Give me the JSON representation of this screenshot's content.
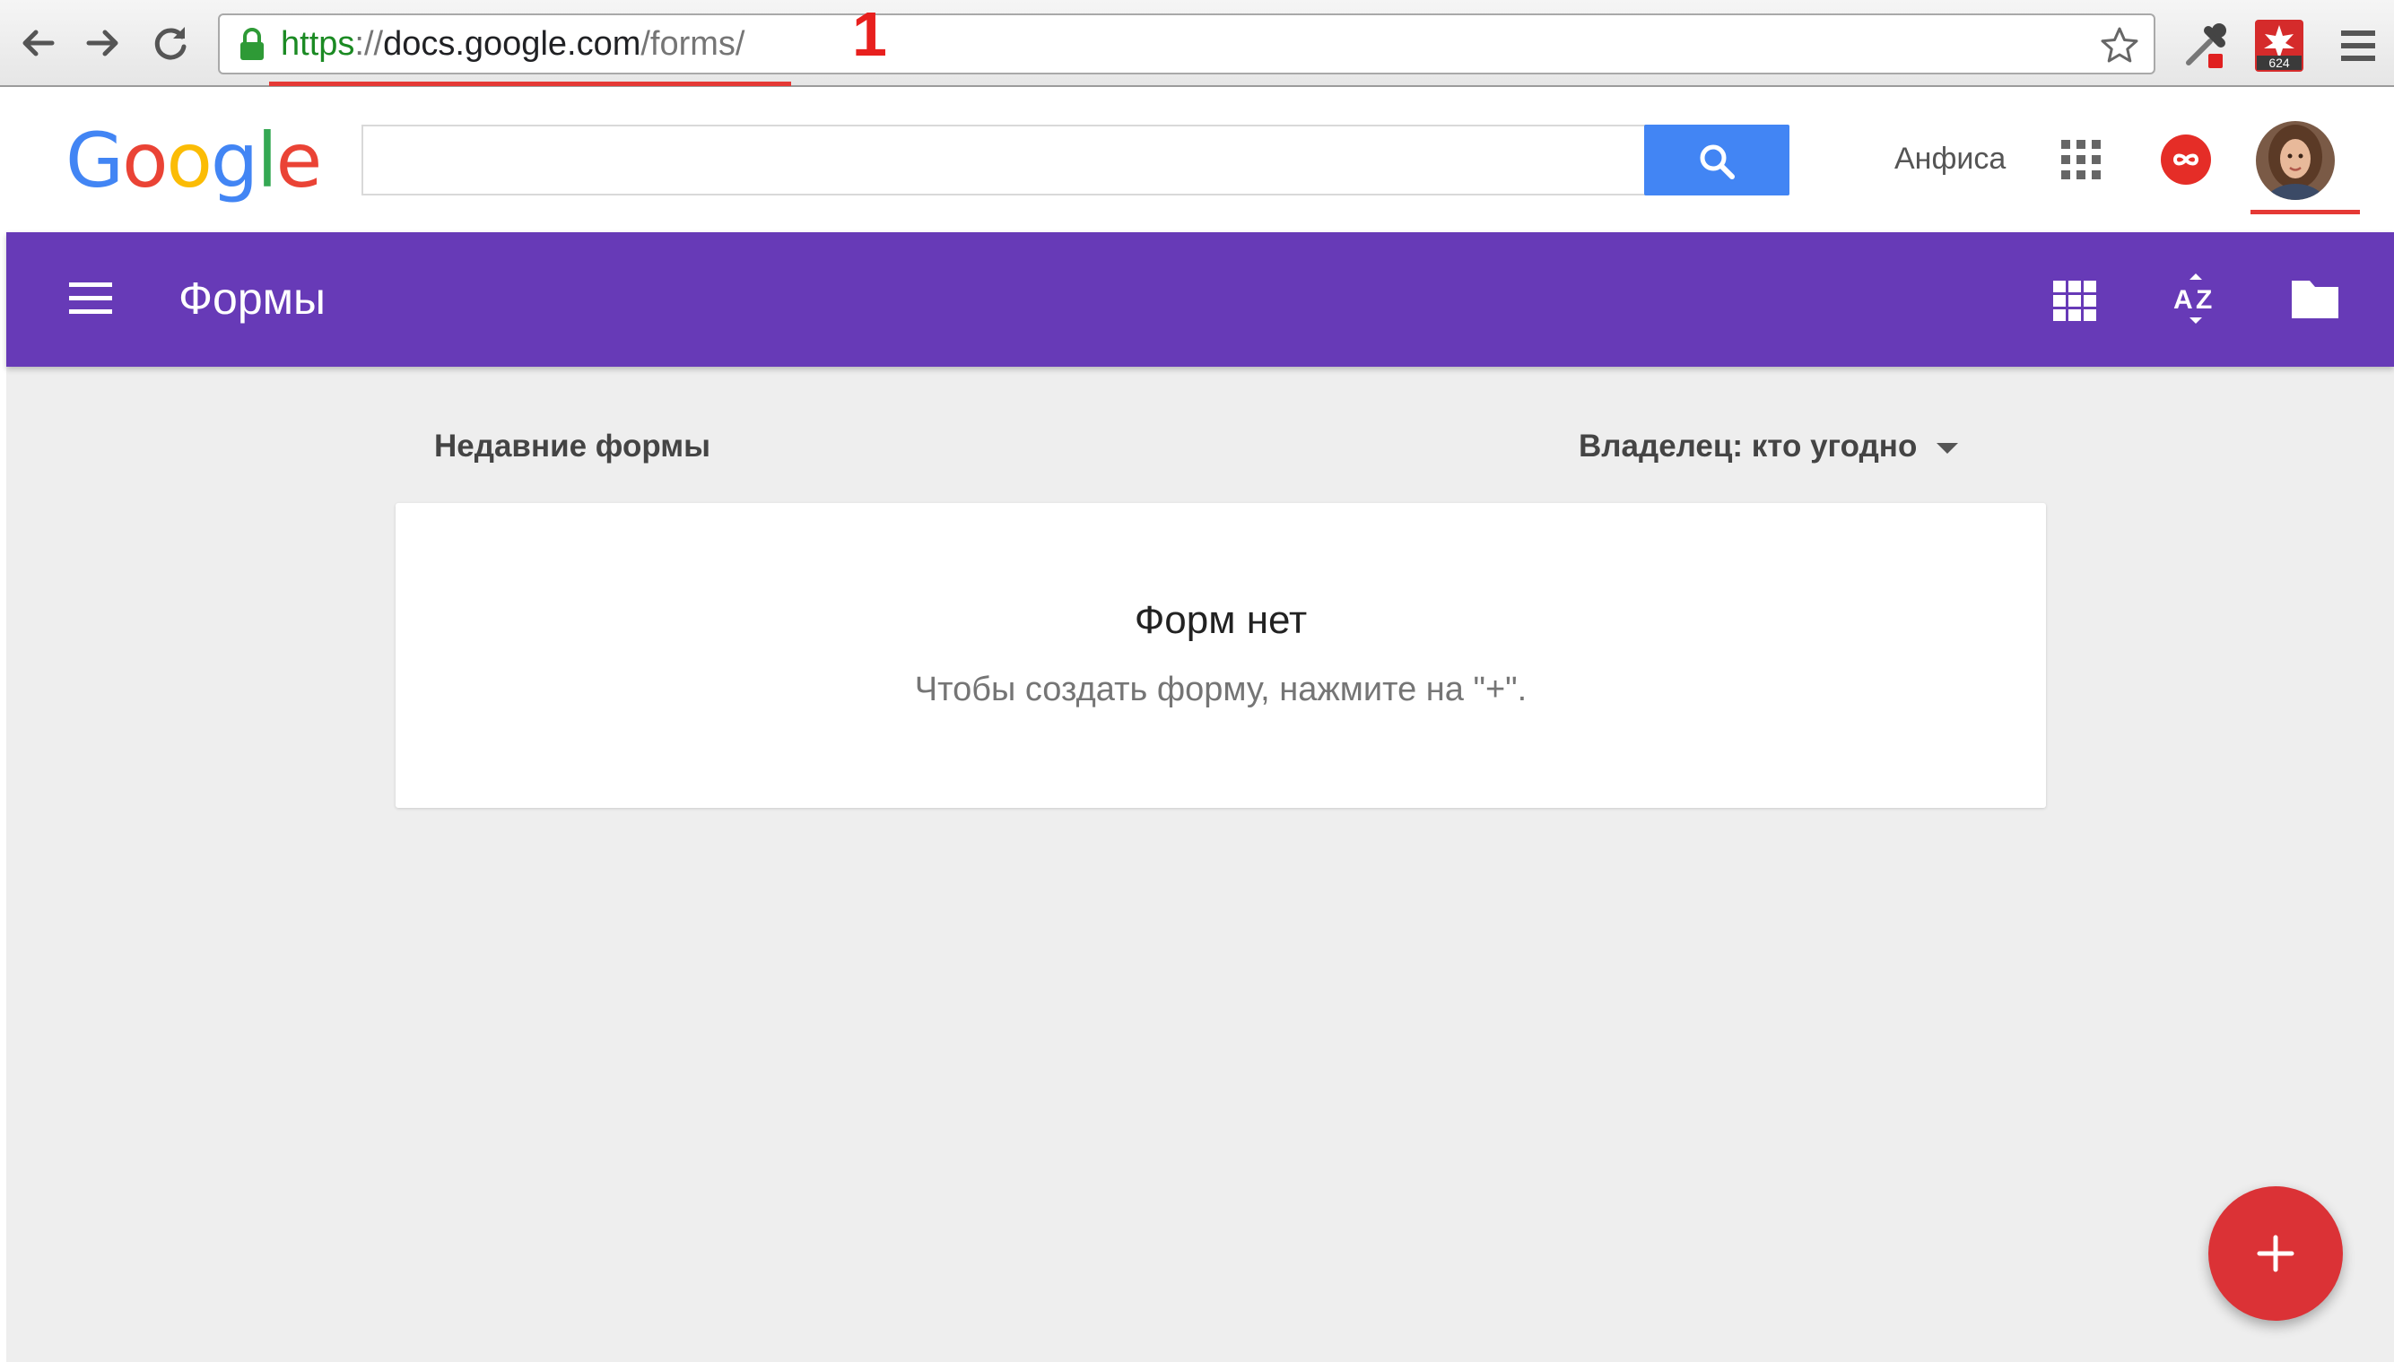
{
  "browser": {
    "url": {
      "scheme": "https",
      "separator": "://",
      "host": "docs.google.com",
      "path": "/forms/"
    },
    "annotation_number": "1",
    "extension_badge": "624"
  },
  "google_header": {
    "logo_letters": [
      {
        "char": "G",
        "color": "#4285f4"
      },
      {
        "char": "o",
        "color": "#ea4335"
      },
      {
        "char": "o",
        "color": "#fbbc05"
      },
      {
        "char": "g",
        "color": "#4285f4"
      },
      {
        "char": "l",
        "color": "#34a853"
      },
      {
        "char": "e",
        "color": "#ea4335"
      }
    ],
    "search_value": "",
    "user_name": "Анфиса"
  },
  "app_bar": {
    "title": "Формы",
    "color": "#673ab7"
  },
  "content": {
    "section_title": "Недавние формы",
    "owner_filter": "Владелец: кто угодно",
    "empty_title": "Форм нет",
    "empty_hint": "Чтобы создать форму, нажмите на \"+\"."
  },
  "icons": {
    "back": "arrow-left-icon",
    "forward": "arrow-right-icon",
    "reload": "reload-icon",
    "lock": "lock-icon",
    "bookmark": "star-icon",
    "eyedropper": "eyedropper-icon",
    "extension": "extension-icon",
    "browser_menu": "menu-icon",
    "search": "search-icon",
    "apps": "apps-grid-icon",
    "infinity": "infinity-icon",
    "hamburger": "hamburger-icon",
    "grid_view": "grid-view-icon",
    "sort_az": "sort-az-icon",
    "folder": "folder-icon",
    "add": "plus-icon"
  },
  "colors": {
    "accent_red": "#db3236",
    "search_button": "#4285f4"
  }
}
